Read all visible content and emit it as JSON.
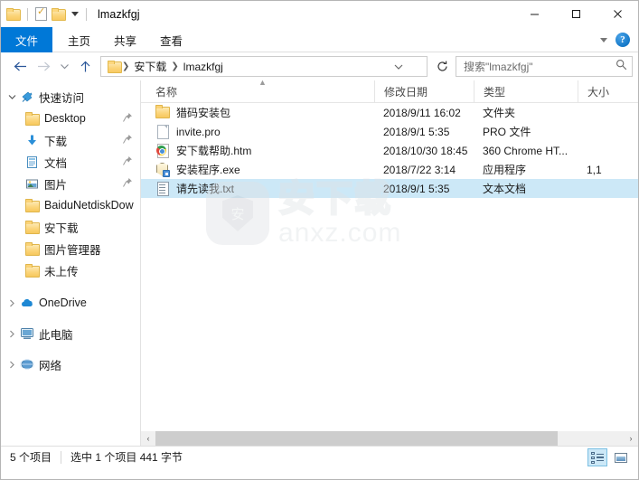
{
  "window": {
    "title": "lmazkfgj",
    "quick_access_toolbar": [
      {
        "name": "folder-icon",
        "label": ""
      },
      {
        "name": "properties-icon",
        "label": ""
      },
      {
        "name": "new-folder-icon",
        "label": ""
      },
      {
        "name": "customize-caret-icon",
        "label": ""
      }
    ],
    "controls": {
      "minimize": "minimize-icon",
      "maximize": "maximize-icon",
      "close": "close-icon"
    }
  },
  "ribbon": {
    "tabs": [
      {
        "label": "文件",
        "active_file_tab": true
      },
      {
        "label": "主页",
        "active_file_tab": false
      },
      {
        "label": "共享",
        "active_file_tab": false
      },
      {
        "label": "查看",
        "active_file_tab": false
      }
    ],
    "collapse_icon": "chevron-down-icon",
    "help_label": "?"
  },
  "address": {
    "back_icon": "back-arrow-icon",
    "forward_icon": "forward-arrow-icon",
    "recent_icon": "recent-locations-icon",
    "up_icon": "up-arrow-icon",
    "breadcrumbs": [
      "安下载",
      "lmazkfgj"
    ],
    "dropdown_icon": "chevron-down-icon",
    "refresh_icon": "refresh-icon"
  },
  "search": {
    "placeholder": "搜索\"lmazkfgj\"",
    "icon": "search-icon"
  },
  "sidebar": {
    "items": [
      {
        "label": "快速访问",
        "level": "root",
        "icon": "pin-star-icon",
        "expander": "chevron-down-icon",
        "pinned": false,
        "highlight": true
      },
      {
        "label": "Desktop",
        "level": "child",
        "icon": "folder-icon",
        "expander": "",
        "pinned": true,
        "highlight": false
      },
      {
        "label": "下载",
        "level": "child",
        "icon": "download-icon",
        "expander": "",
        "pinned": true,
        "highlight": false
      },
      {
        "label": "文档",
        "level": "child",
        "icon": "documents-icon",
        "expander": "",
        "pinned": true,
        "highlight": false
      },
      {
        "label": "图片",
        "level": "child",
        "icon": "pictures-icon",
        "expander": "",
        "pinned": true,
        "highlight": false
      },
      {
        "label": "BaiduNetdiskDow",
        "level": "child",
        "icon": "folder-icon",
        "expander": "",
        "pinned": false,
        "highlight": false
      },
      {
        "label": "安下载",
        "level": "child",
        "icon": "folder-icon",
        "expander": "",
        "pinned": false,
        "highlight": false
      },
      {
        "label": "图片管理器",
        "level": "child",
        "icon": "folder-icon",
        "expander": "",
        "pinned": false,
        "highlight": false
      },
      {
        "label": "未上传",
        "level": "child",
        "icon": "folder-icon",
        "expander": "",
        "pinned": false,
        "highlight": false
      },
      {
        "label": "OneDrive",
        "level": "root",
        "icon": "onedrive-icon",
        "expander": "chevron-right-icon",
        "pinned": false,
        "highlight": false
      },
      {
        "label": "此电脑",
        "level": "root",
        "icon": "this-pc-icon",
        "expander": "chevron-right-icon",
        "pinned": false,
        "highlight": false
      },
      {
        "label": "网络",
        "level": "root",
        "icon": "network-icon",
        "expander": "chevron-right-icon",
        "pinned": false,
        "highlight": false
      }
    ]
  },
  "filelist": {
    "columns": [
      {
        "label": "名称",
        "key": "name"
      },
      {
        "label": "修改日期",
        "key": "date"
      },
      {
        "label": "类型",
        "key": "type"
      },
      {
        "label": "大小",
        "key": "size"
      }
    ],
    "sort_indicator": "▲",
    "rows": [
      {
        "name": "猎码安装包",
        "date": "2018/9/11 16:02",
        "type": "文件夹",
        "size": "",
        "icon": "folder-icon",
        "selected": false
      },
      {
        "name": "invite.pro",
        "date": "2018/9/1 5:35",
        "type": "PRO 文件",
        "size": "",
        "icon": "blank-document-icon",
        "selected": false
      },
      {
        "name": "安下载帮助.htm",
        "date": "2018/10/30 18:45",
        "type": "360 Chrome HT...",
        "size": "",
        "icon": "chrome-html-icon",
        "selected": false
      },
      {
        "name": "安装程序.exe",
        "date": "2018/7/22 3:14",
        "type": "应用程序",
        "size": "1,1",
        "icon": "installer-exe-icon",
        "selected": false
      },
      {
        "name": "请先读我.txt",
        "date": "2018/9/1 5:35",
        "type": "文本文档",
        "size": "",
        "icon": "text-document-icon",
        "selected": true
      }
    ]
  },
  "watermark": {
    "cn": "安下载",
    "en": "anxz.com",
    "logo_char": "安"
  },
  "scrollbar": {
    "left_arrow": "‹",
    "right_arrow": "›"
  },
  "status": {
    "item_count": "5 个项目",
    "selection": "选中 1 个项目  441 字节",
    "view_details_icon": "details-view-icon",
    "view_thumbnails_icon": "large-icons-view-icon"
  },
  "colors": {
    "accent": "#0078d7",
    "selection": "#cce8f7",
    "folder_yellow": "#fbd377"
  }
}
